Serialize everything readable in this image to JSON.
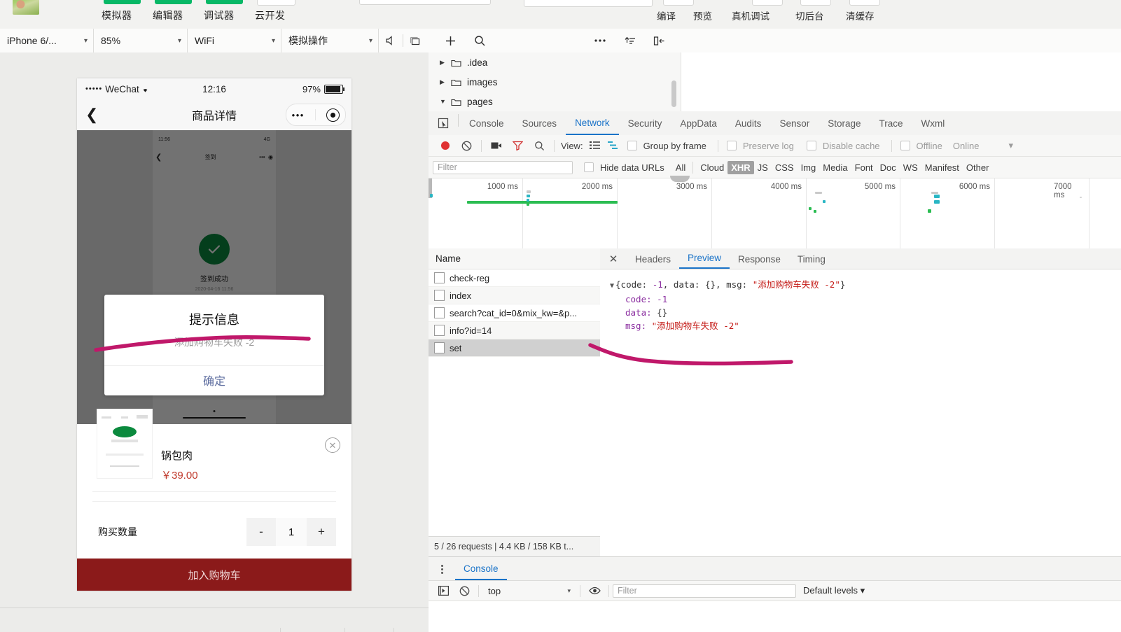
{
  "app_toolbar": {
    "nav_buttons": [
      {
        "label": "模拟器",
        "style": "green"
      },
      {
        "label": "编辑器",
        "style": "green"
      },
      {
        "label": "调试器",
        "style": "green"
      },
      {
        "label": "云开发",
        "style": "white"
      }
    ],
    "right_buttons": [
      {
        "label": "编译"
      },
      {
        "label": "预览"
      },
      {
        "label": "真机调试"
      },
      {
        "label": "切后台"
      },
      {
        "label": "清缓存"
      }
    ]
  },
  "simulator_bar": {
    "device": "iPhone 6/...",
    "zoom": "85%",
    "network": "WiFi",
    "operation": "模拟操作",
    "caret": "▾",
    "icons": [
      "volume-icon",
      "rotate-icon"
    ]
  },
  "phone": {
    "status_bar": {
      "signal_dots": "•••••",
      "carrier": "WeChat",
      "wifi": "≈",
      "time": "12:16",
      "battery_percent": "97%"
    },
    "nav_bar": {
      "back": "❮",
      "title": "商品详情",
      "capsule_dots": "•••"
    },
    "screenshot": {
      "status_time": "11:56",
      "status_right": "4G",
      "nav_title": "签到",
      "success_text": "签到成功",
      "date_text": "2020-04-16 11:56"
    },
    "dialog": {
      "title": "提示信息",
      "message": "添加购物车失败 -2",
      "confirm": "确定"
    },
    "sheet": {
      "product_name": "锅包肉",
      "price": "￥39.00",
      "qty_label": "购买数量",
      "qty_minus": "-",
      "qty_value": "1",
      "qty_plus": "+",
      "cart_button": "加入购物车",
      "close": "✕"
    }
  },
  "file_tree": {
    "toolbar_icons": [
      "plus-icon",
      "search-icon",
      "more-icon",
      "sort-icon",
      "collapse-panel-icon"
    ],
    "items": [
      {
        "arrow": "▶",
        "label": ".idea"
      },
      {
        "arrow": "▶",
        "label": "images"
      },
      {
        "arrow": "▼",
        "label": "pages"
      }
    ]
  },
  "devtools": {
    "tabs": [
      {
        "label": "Console",
        "active": false
      },
      {
        "label": "Sources",
        "active": false
      },
      {
        "label": "Network",
        "active": true
      },
      {
        "label": "Security",
        "active": false
      },
      {
        "label": "AppData",
        "active": false
      },
      {
        "label": "Audits",
        "active": false
      },
      {
        "label": "Sensor",
        "active": false
      },
      {
        "label": "Storage",
        "active": false
      },
      {
        "label": "Trace",
        "active": false
      },
      {
        "label": "Wxml",
        "active": false
      }
    ],
    "network_toolbar": {
      "view_label": "View:",
      "group_by_frame": "Group by frame",
      "preserve_log": "Preserve log",
      "disable_cache": "Disable cache",
      "offline": "Offline",
      "online": "Online",
      "caret": "▾"
    },
    "filter_row": {
      "filter_placeholder": "Filter",
      "hide_data_urls": "Hide data URLs",
      "types": [
        "All",
        "Cloud",
        "XHR",
        "JS",
        "CSS",
        "Img",
        "Media",
        "Font",
        "Doc",
        "WS",
        "Manifest",
        "Other"
      ],
      "selected_type": "XHR"
    },
    "timeline": {
      "ticks": [
        "1000 ms",
        "2000 ms",
        "3000 ms",
        "4000 ms",
        "5000 ms",
        "6000 ms",
        "7000 ms"
      ]
    },
    "requests": {
      "column_header": "Name",
      "rows": [
        {
          "name": "check-reg",
          "selected": false
        },
        {
          "name": "index",
          "selected": false
        },
        {
          "name": "search?cat_id=0&mix_kw=&p...",
          "selected": false
        },
        {
          "name": "info?id=14",
          "selected": false
        },
        {
          "name": "set",
          "selected": true
        }
      ],
      "footer": "5 / 26 requests  |  4.4 KB / 158 KB t..."
    },
    "detail": {
      "close": "✕",
      "tabs": [
        {
          "label": "Headers",
          "active": false
        },
        {
          "label": "Preview",
          "active": true
        },
        {
          "label": "Response",
          "active": false
        },
        {
          "label": "Timing",
          "active": false
        }
      ],
      "preview": {
        "summary_prefix": "{code: ",
        "summary_code": "-1",
        "summary_mid": ", data: {}, msg: ",
        "summary_msg": "\"添加购物车失败 -2\"",
        "summary_suffix": "}",
        "lines": [
          {
            "key": "code:",
            "value": "-1",
            "kind": "num"
          },
          {
            "key": "data:",
            "value": "{}",
            "kind": "plain"
          },
          {
            "key": "msg:",
            "value": "\"添加购物车失败 -2\"",
            "kind": "str"
          }
        ]
      }
    },
    "console_drawer": {
      "tab": "Console",
      "context": "top",
      "context_caret": "▾",
      "filter_placeholder": "Filter",
      "levels": "Default levels ▾"
    }
  },
  "colors": {
    "accent_blue": "#1a73c8",
    "wechat_green": "#07b866",
    "annotation_pink": "#c0186a",
    "record_red": "#e03232",
    "cart_red": "#8b1a1a",
    "price_red": "#c0392b"
  }
}
